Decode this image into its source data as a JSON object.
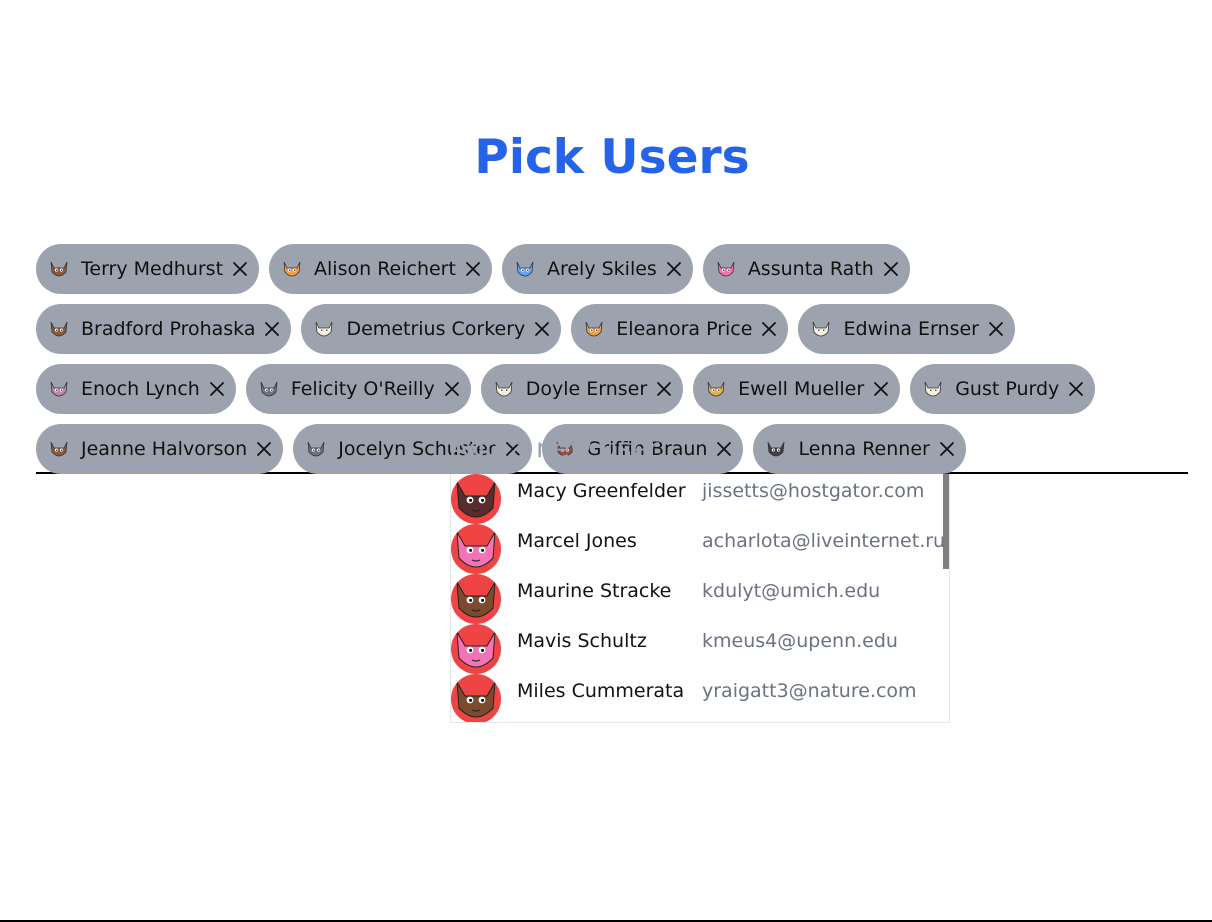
{
  "page": {
    "title": "Pick Users"
  },
  "selected_users": [
    {
      "name": "Terry Medhurst",
      "avatar_color": "#8b5a3c",
      "icon": "cat-avatar-icon"
    },
    {
      "name": "Alison Reichert",
      "avatar_color": "#f59e42",
      "icon": "cat-avatar-icon"
    },
    {
      "name": "Arely Skiles",
      "avatar_color": "#60a5fa",
      "icon": "cat-avatar-icon"
    },
    {
      "name": "Assunta Rath",
      "avatar_color": "#f472b6",
      "icon": "cat-avatar-icon"
    },
    {
      "name": "Bradford Prohaska",
      "avatar_color": "#8b5a3c",
      "icon": "cat-avatar-icon"
    },
    {
      "name": "Demetrius Corkery",
      "avatar_color": "#f5f0dc",
      "icon": "cat-avatar-icon"
    },
    {
      "name": "Eleanora Price",
      "avatar_color": "#f59e42",
      "icon": "cat-avatar-icon"
    },
    {
      "name": "Edwina Ernser",
      "avatar_color": "#f5f0dc",
      "icon": "cat-avatar-icon"
    },
    {
      "name": "Enoch Lynch",
      "avatar_color": "#c084b4",
      "icon": "cat-avatar-icon"
    },
    {
      "name": "Felicity O'Reilly",
      "avatar_color": "#6b7280",
      "icon": "cat-avatar-icon"
    },
    {
      "name": "Doyle Ernser",
      "avatar_color": "#f5f0dc",
      "icon": "cat-avatar-icon"
    },
    {
      "name": "Ewell Mueller",
      "avatar_color": "#e8b04a",
      "icon": "cat-avatar-icon"
    },
    {
      "name": "Gust Purdy",
      "avatar_color": "#f5f0dc",
      "icon": "cat-avatar-icon"
    },
    {
      "name": "Jeanne Halvorson",
      "avatar_color": "#8b5a3c",
      "icon": "cat-avatar-icon"
    },
    {
      "name": "Jocelyn Schuster",
      "avatar_color": "#6b7280",
      "icon": "cat-avatar-icon"
    },
    {
      "name": "Griffin Braun",
      "avatar_color": "#9b4a4a",
      "icon": "cat-avatar-icon"
    },
    {
      "name": "Lenna Renner",
      "avatar_color": "#3f3f46",
      "icon": "cat-avatar-icon"
    }
  ],
  "input": {
    "placeholder": "Add a new user...",
    "value": ""
  },
  "suggestions": [
    {
      "name": "Macy Greenfelder",
      "email": "jissetts@hostgator.com",
      "avatar_bg": "#ef4444",
      "avatar_color": "#5a2d2d"
    },
    {
      "name": "Marcel Jones",
      "email": "acharlota@liveinternet.ru",
      "avatar_bg": "#ef4444",
      "avatar_color": "#f472b6"
    },
    {
      "name": "Maurine Stracke",
      "email": "kdulyt@umich.edu",
      "avatar_bg": "#ef4444",
      "avatar_color": "#7c4a2d"
    },
    {
      "name": "Mavis Schultz",
      "email": "kmeus4@upenn.edu",
      "avatar_bg": "#ef4444",
      "avatar_color": "#f472b6"
    },
    {
      "name": "Miles Cummerata",
      "email": "yraigatt3@nature.com",
      "avatar_bg": "#ef4444",
      "avatar_color": "#7c4a2d"
    }
  ],
  "colors": {
    "title": "#2563eb",
    "chip_bg": "#9ca3af",
    "email_text": "#6b7280"
  }
}
